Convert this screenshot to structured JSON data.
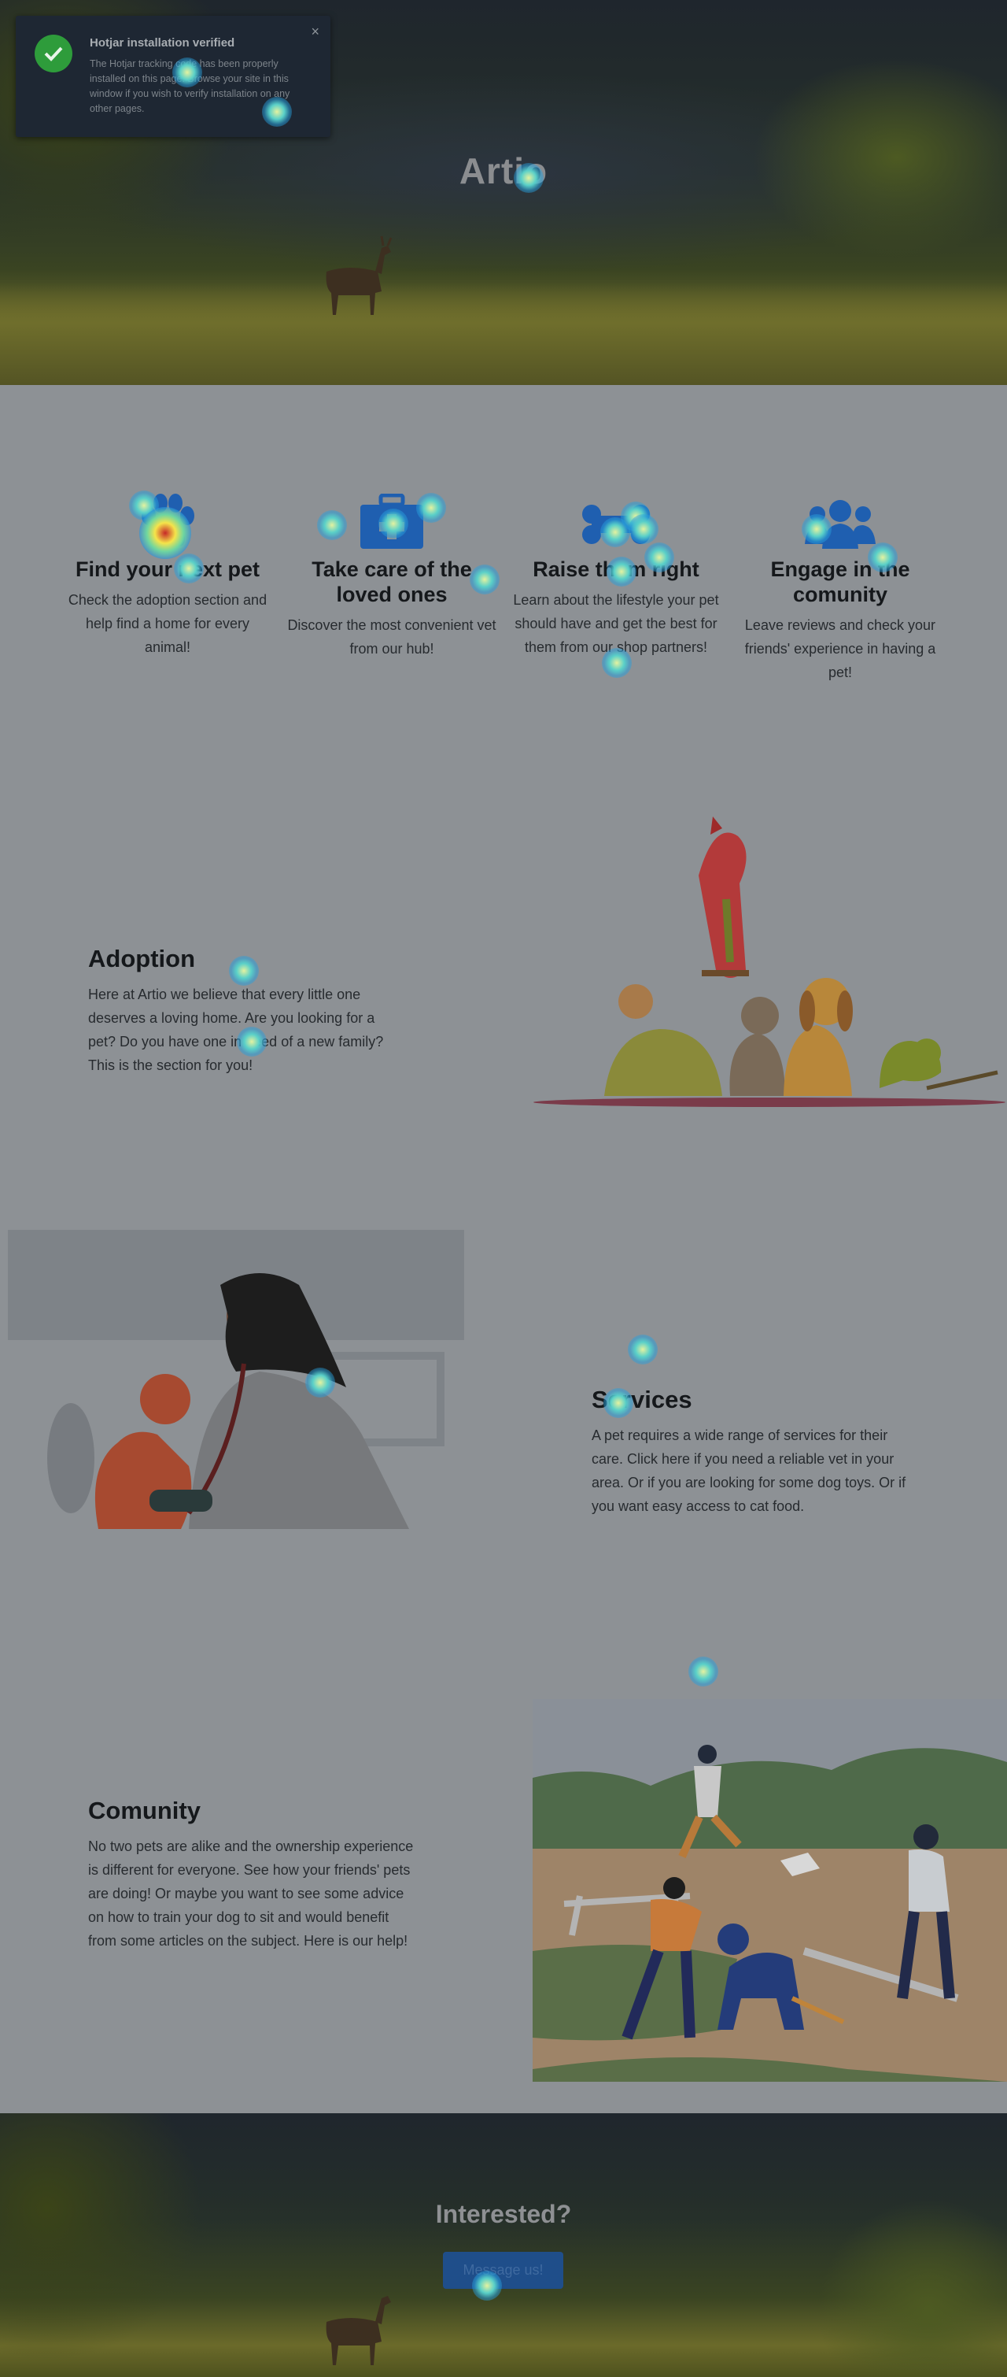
{
  "hero": {
    "title": "Artio"
  },
  "hotjar": {
    "title": "Hotjar installation verified",
    "text": "The Hotjar tracking code has been properly installed on this page. Browse your site in this window if you wish to verify installation on any other pages.",
    "close_icon": "×"
  },
  "features": [
    {
      "icon": "paw-icon",
      "title": "Find your next pet",
      "text": "Check the adoption section and help find a home for every animal!"
    },
    {
      "icon": "medical-kit-icon",
      "title": "Take care of the loved ones",
      "text": "Discover the most convenient vet from our hub!"
    },
    {
      "icon": "bone-icon",
      "title": "Raise them right",
      "text": "Learn about the lifestyle your pet should have and get the best for them from our shop partners!"
    },
    {
      "icon": "users-icon",
      "title": "Engage in the comunity",
      "text": "Leave reviews and check your friends' experience in having a pet!"
    }
  ],
  "adoption": {
    "title": "Adoption",
    "text": "Here at Artio we believe that every little one deserves a loving home. Are you looking for a pet? Do you have one in need of a new family? This is the section for you!"
  },
  "services": {
    "title": "Services",
    "text": "A pet requires a wide range of services for their care. Click here if you need a reliable vet in your area. Or if you are looking for some dog toys. Or if you want easy access to cat food."
  },
  "comunity": {
    "title": "Comunity",
    "text": "No two pets are alike and the ownership experience is different for everyone. See how your friends' pets are doing! Or maybe you want to see some advice on how to train your dog to sit and would benefit from some articles on the subject. Here is our help!"
  },
  "cta": {
    "title": "Interested?",
    "button": "Message us!"
  },
  "colors": {
    "accent": "#1f4e8a",
    "icon_blue": "#1f5fb0",
    "overlay": "#8d9195"
  }
}
